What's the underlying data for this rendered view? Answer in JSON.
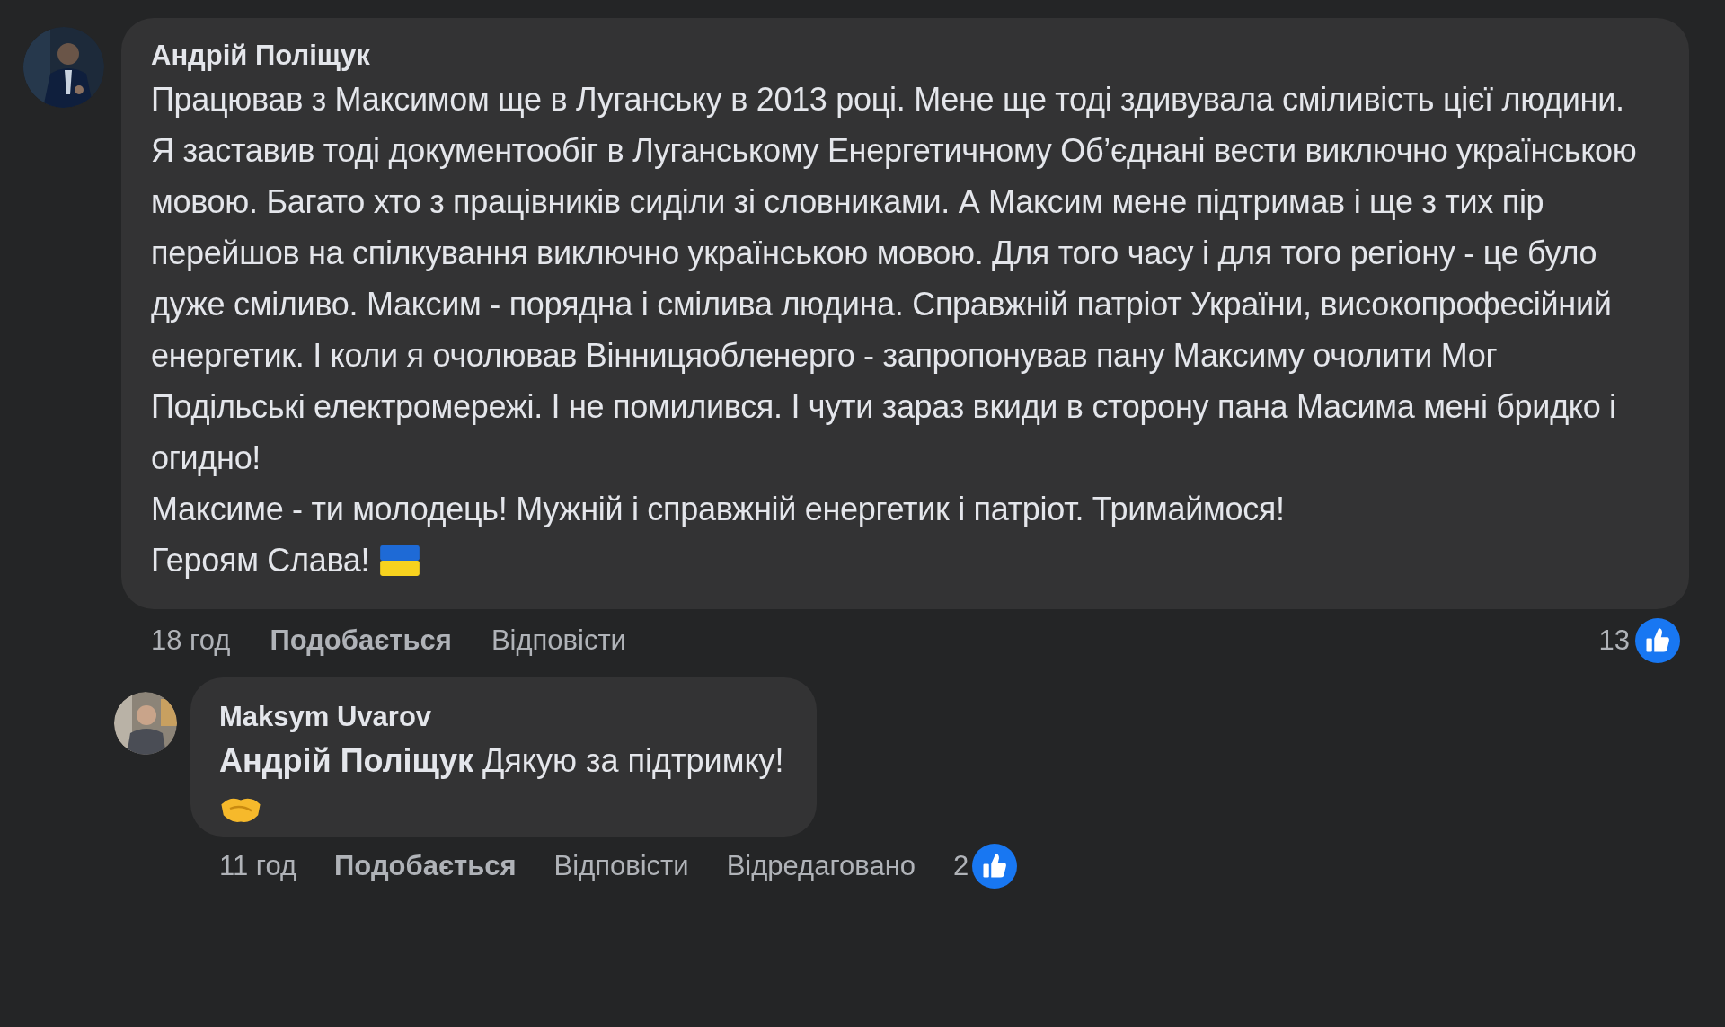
{
  "comments": [
    {
      "author": "Андрій Поліщук",
      "paragraphs": [
        "Працював з Максимом ще в Луганську в 2013 році. Мене ще тоді здивувала сміливість цієї людини. Я заставив тоді документообіг в Луганському Енергетичному Об’єднані вести виключно українською мовою. Багато хто з працівників сиділи зі словниками. А Максим мене підтримав і ще з тих пір перейшов на спілкування виключно українською мовою. Для того часу і для того регіону - це було дуже сміливо. Максим - порядна і смілива людина. Справжній патріот України, високопрофесійний енергетик. І коли я очолював Вінницяобленерго - запропонував пану Максиму очолити Мог Подільські електромережі. І не помилився. І чути зараз вкиди в сторону пана Масима мені бридко і огидно!",
        "Максиме - ти молодець! Мужній і справжній енергетик і патріот. Тримаймося!",
        "Героям Слава!"
      ],
      "time": "18 год",
      "like": "Подобається",
      "reply": "Відповісти",
      "reactions": "13",
      "replies": [
        {
          "author": "Maksym Uvarov",
          "paragraphs": [
            "**Андрій Поліщук** Дякую за підтримку!"
          ],
          "time": "11 год",
          "like": "Подобається",
          "reply": "Відповісти",
          "edited": "Відредаговано",
          "reactions": "2"
        }
      ]
    }
  ]
}
